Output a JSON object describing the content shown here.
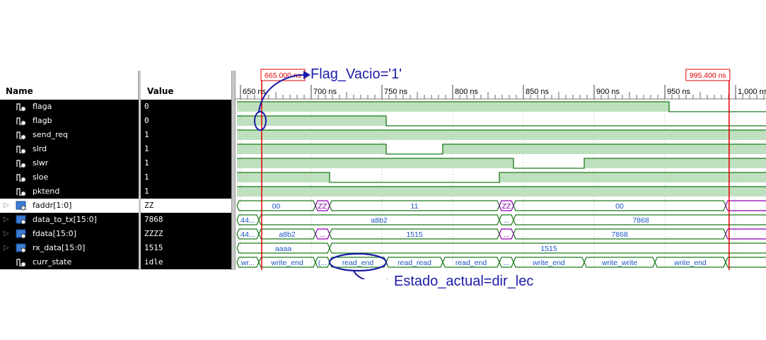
{
  "headers": {
    "name": "Name",
    "value": "Value"
  },
  "cursors": [
    {
      "label": "665.000 ns",
      "time": 665
    },
    {
      "label": "995.400 ns",
      "time": 995.4
    }
  ],
  "timescale": {
    "start": 647.5,
    "end": 1023,
    "ticks": [
      {
        "t": 650,
        "label": "650 ns"
      },
      {
        "t": 700,
        "label": "700 ns"
      },
      {
        "t": 750,
        "label": "750 ns"
      },
      {
        "t": 800,
        "label": "800 ns"
      },
      {
        "t": 850,
        "label": "850 ns"
      },
      {
        "t": 900,
        "label": "900 ns"
      },
      {
        "t": 950,
        "label": "950 ns"
      },
      {
        "t": 1000,
        "label": "1,000 ns"
      }
    ]
  },
  "signals": [
    {
      "name": "flaga",
      "value": "0",
      "bus": false
    },
    {
      "name": "flagb",
      "value": "0",
      "bus": false
    },
    {
      "name": "send_req",
      "value": "1",
      "bus": false
    },
    {
      "name": "slrd",
      "value": "1",
      "bus": false
    },
    {
      "name": "slwr",
      "value": "1",
      "bus": false
    },
    {
      "name": "sloe",
      "value": "1",
      "bus": false
    },
    {
      "name": "pktend",
      "value": "1",
      "bus": false
    },
    {
      "name": "faddr[1:0]",
      "value": "ZZ",
      "bus": true,
      "selected": true
    },
    {
      "name": "data_to_tx[15:0]",
      "value": "7868",
      "bus": true
    },
    {
      "name": "fdata[15:0]",
      "value": "ZZZZ",
      "bus": true
    },
    {
      "name": "rx_data[15:0]",
      "value": "1515",
      "bus": true
    },
    {
      "name": "curr_state",
      "value": "idle",
      "bus": false
    }
  ],
  "waves": {
    "flaga": [
      [
        647.5,
        1
      ],
      [
        953,
        0
      ]
    ],
    "flagb": [
      [
        647.5,
        1
      ],
      [
        753,
        0
      ]
    ],
    "send_req": [
      [
        647.5,
        1
      ]
    ],
    "slrd": [
      [
        647.5,
        1
      ],
      [
        753,
        0
      ],
      [
        793,
        1
      ]
    ],
    "slwr": [
      [
        647.5,
        1
      ],
      [
        843,
        0
      ],
      [
        893,
        1
      ]
    ],
    "sloe": [
      [
        647.5,
        1
      ],
      [
        713,
        0
      ],
      [
        833,
        1
      ]
    ],
    "pktend": [
      [
        647.5,
        1
      ]
    ],
    "faddr[1:0]": [
      {
        "t0": 647.5,
        "t1": 703,
        "text": "00"
      },
      {
        "t0": 703,
        "t1": 713,
        "text": "ZZ",
        "z": true
      },
      {
        "t0": 713,
        "t1": 833,
        "text": "11"
      },
      {
        "t0": 833,
        "t1": 843,
        "text": "ZZ",
        "z": true
      },
      {
        "t0": 843,
        "t1": 993,
        "text": "00"
      },
      {
        "t0": 993,
        "t1": 1023,
        "text": "",
        "z": true
      }
    ],
    "data_to_tx[15:0]": [
      {
        "t0": 647.5,
        "t1": 663,
        "text": "44..."
      },
      {
        "t0": 663,
        "t1": 833,
        "text": "a8b2"
      },
      {
        "t0": 833,
        "t1": 843,
        "text": "..."
      },
      {
        "t0": 843,
        "t1": 1023,
        "text": "7868"
      }
    ],
    "fdata[15:0]": [
      {
        "t0": 647.5,
        "t1": 663,
        "text": "44..."
      },
      {
        "t0": 663,
        "t1": 703,
        "text": "a8b2"
      },
      {
        "t0": 703,
        "t1": 713,
        "text": "...",
        "z": true
      },
      {
        "t0": 713,
        "t1": 833,
        "text": "1515"
      },
      {
        "t0": 833,
        "t1": 843,
        "text": "...",
        "z": true
      },
      {
        "t0": 843,
        "t1": 993,
        "text": "7868"
      },
      {
        "t0": 993,
        "t1": 1023,
        "text": "",
        "z": true
      }
    ],
    "rx_data[15:0]": [
      {
        "t0": 647.5,
        "t1": 713,
        "text": "aaaa"
      },
      {
        "t0": 713,
        "t1": 1023,
        "text": "1515"
      }
    ],
    "curr_state": [
      {
        "t0": 647.5,
        "t1": 663,
        "text": "wr..."
      },
      {
        "t0": 663,
        "t1": 703,
        "text": "write_end"
      },
      {
        "t0": 703,
        "t1": 713,
        "text": "(..."
      },
      {
        "t0": 713,
        "t1": 753,
        "text": "read_end"
      },
      {
        "t0": 753,
        "t1": 793,
        "text": "read_read"
      },
      {
        "t0": 793,
        "t1": 833,
        "text": "read_end"
      },
      {
        "t0": 833,
        "t1": 843,
        "text": "..."
      },
      {
        "t0": 843,
        "t1": 893,
        "text": "write_end"
      },
      {
        "t0": 893,
        "t1": 943,
        "text": "write_write"
      },
      {
        "t0": 943,
        "t1": 993,
        "text": "write_end"
      },
      {
        "t0": 993,
        "t1": 1023,
        "text": ""
      }
    ]
  },
  "annotations": {
    "flag": "Flag_Vacio='1'",
    "state": "Estado_actual=dir_lec"
  },
  "colors": {
    "wave": "#1a7a1a",
    "fill": "#bfe0bf",
    "cursor": "#e00000",
    "z": "#8b00b0",
    "text": "#1a55c0",
    "annot": "#1a1aa8",
    "row_bg": "#000000"
  }
}
